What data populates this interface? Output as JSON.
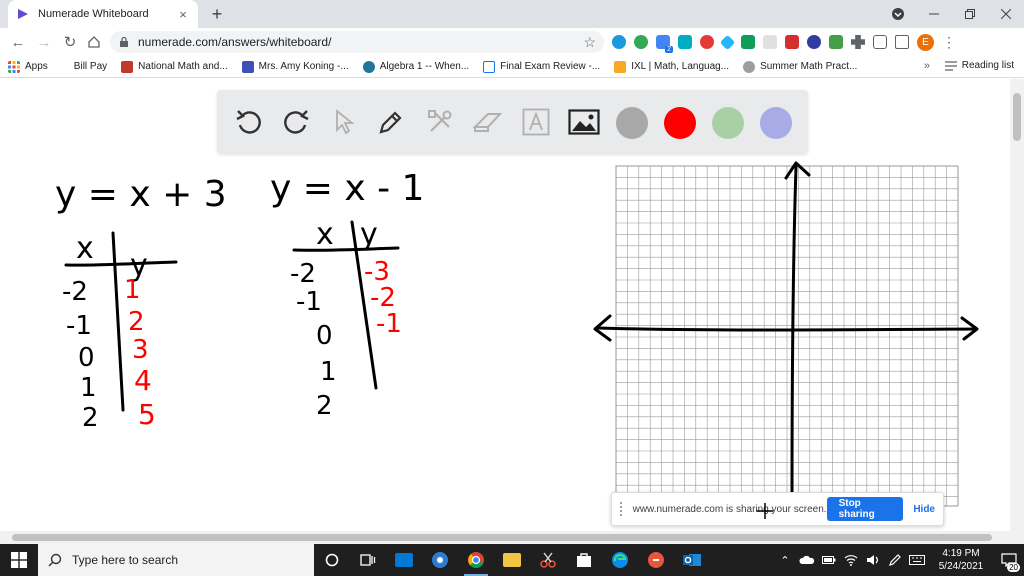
{
  "browser": {
    "tab_title": "Numerade Whiteboard",
    "tab_close": "×",
    "new_tab": "+",
    "url": "numerade.com/answers/whiteboard/",
    "profile_initial": "E",
    "ext_badge": "2"
  },
  "bookmarks": {
    "items": [
      {
        "label": "Apps",
        "color": "#4285f4"
      },
      {
        "label": "Bill Pay",
        "color": "#ffffff"
      },
      {
        "label": "National Math and...",
        "color": "#c0392b"
      },
      {
        "label": "Mrs. Amy Koning -...",
        "color": "#3f51b5"
      },
      {
        "label": "Algebra 1 -- When...",
        "color": "#21759b"
      },
      {
        "label": "Final Exam Review -...",
        "color": "#1a73e8"
      },
      {
        "label": "IXL | Math, Languag...",
        "color": "#f9a825"
      },
      {
        "label": "Summer Math Pract...",
        "color": "#9e9e9e"
      }
    ],
    "more": "»",
    "reading_list": "Reading list"
  },
  "whiteboard": {
    "tools": [
      "undo-icon",
      "redo-icon",
      "pointer-icon",
      "pen-icon",
      "tools-icon",
      "eraser-icon",
      "text-icon",
      "image-icon"
    ],
    "colors": [
      "#a8a8a8",
      "#ff0000",
      "#a9cfa6",
      "#a8ace6"
    ],
    "eq1": "y = x + 3",
    "eq2": "y = x - 1",
    "table_header_x": "x",
    "table_header_y": "y",
    "table1_x": [
      "-2",
      "-1",
      "0",
      "1",
      "2"
    ],
    "table1_y": [
      "1",
      "2",
      "3",
      "4",
      "5"
    ],
    "table2_x": [
      "-2",
      "-1",
      "0",
      "1",
      "2"
    ],
    "table2_y": [
      "-3",
      "-2",
      "-1"
    ],
    "ink_color": "#000000",
    "answer_color": "#ff0000"
  },
  "share_bar": {
    "text": "www.numerade.com is sharing your screen.",
    "stop": "Stop sharing",
    "hide": "Hide"
  },
  "taskbar": {
    "search_placeholder": "Type here to search",
    "time": "4:19 PM",
    "date": "5/24/2021",
    "notifications": "20"
  }
}
